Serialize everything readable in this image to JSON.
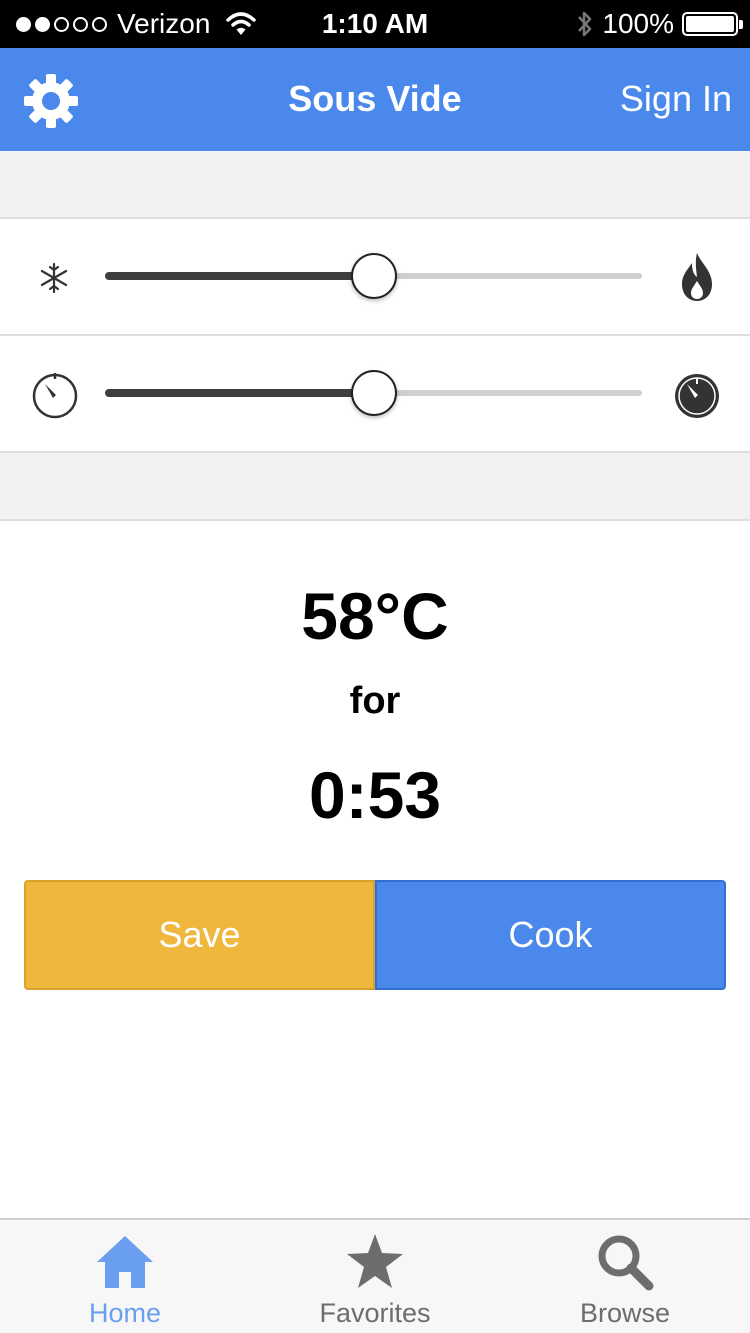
{
  "status_bar": {
    "carrier": "Verizon",
    "time": "1:10 AM",
    "battery": "100%",
    "battery_level": 1.0,
    "signal_bars_filled": 2,
    "signal_bars_total": 5
  },
  "nav": {
    "title": "Sous Vide",
    "sign_in_label": "Sign In",
    "settings_icon": "gear-icon",
    "color": "#4a88ec"
  },
  "sliders": {
    "temperature": {
      "min_icon": "snowflake-icon",
      "max_icon": "flame-icon",
      "level": 0.5
    },
    "time": {
      "min_icon": "timer-empty-icon",
      "max_icon": "timer-full-icon",
      "level": 0.5
    }
  },
  "readout": {
    "temperature": "58°C",
    "connector": "for",
    "duration": "0:53"
  },
  "actions": {
    "save_label": "Save",
    "cook_label": "Cook",
    "save_color": "#f0b73d",
    "cook_color": "#4a88ec"
  },
  "tabs": [
    {
      "label": "Home",
      "icon": "home-icon",
      "active": true
    },
    {
      "label": "Favorites",
      "icon": "star-icon",
      "active": false
    },
    {
      "label": "Browse",
      "icon": "search-icon",
      "active": false
    }
  ]
}
